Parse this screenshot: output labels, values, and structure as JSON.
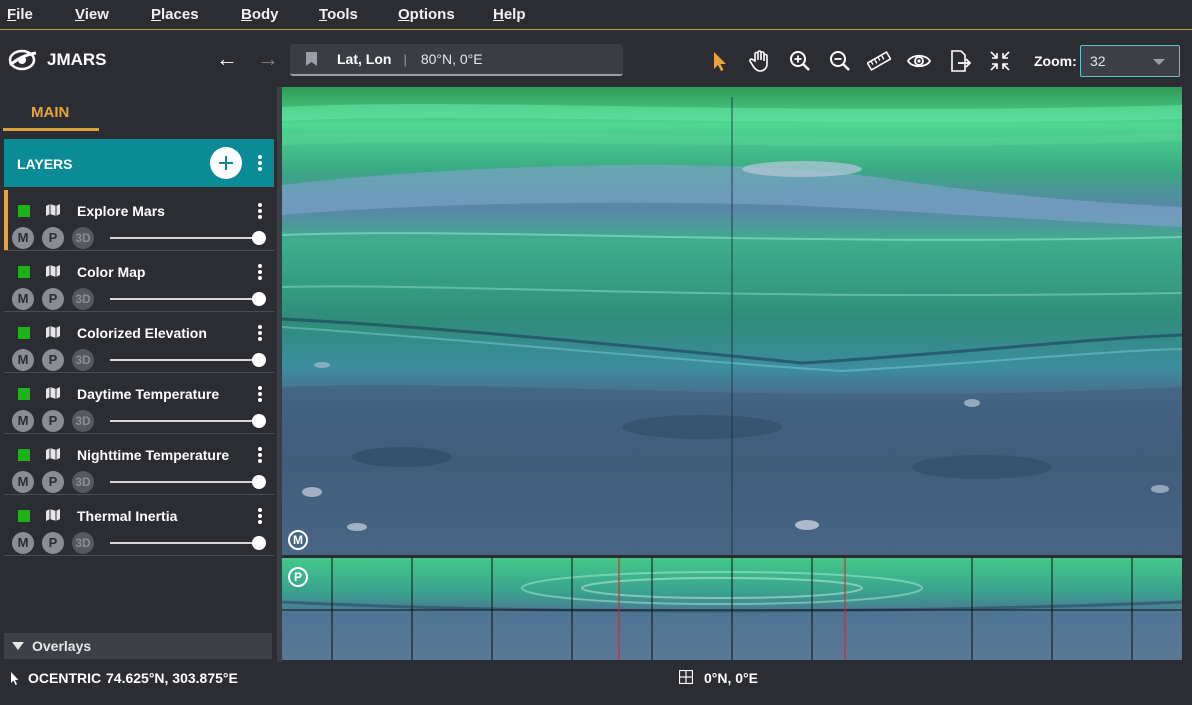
{
  "menu": [
    {
      "label": "File",
      "hotkey": "F",
      "rest": "ile"
    },
    {
      "label": "View",
      "hotkey": "V",
      "rest": "iew"
    },
    {
      "label": "Places",
      "hotkey": "P",
      "rest": "laces"
    },
    {
      "label": "Body",
      "hotkey": "B",
      "rest": "ody"
    },
    {
      "label": "Tools",
      "hotkey": "T",
      "rest": "ools"
    },
    {
      "label": "Options",
      "hotkey": "O",
      "rest": "ptions"
    },
    {
      "label": "Help",
      "hotkey": "H",
      "rest": "elp"
    }
  ],
  "toolbar": {
    "app_title": "JMARS",
    "coord_mode": "Lat, Lon",
    "coord_separator": "|",
    "coord_value": "80°N, 0°E",
    "tools": [
      "pointer-icon",
      "pan-hand-icon",
      "zoom-in-icon",
      "zoom-out-icon",
      "ruler-icon",
      "eye-icon",
      "export-icon",
      "shrink-icon"
    ],
    "zoom_label": "Zoom:",
    "zoom_value": "32",
    "accent_color": "#e8a33c"
  },
  "sidebar": {
    "tab_label": "MAIN",
    "layers_title": "LAYERS",
    "pill_labels": {
      "m": "M",
      "p": "P",
      "three_d": "3D"
    },
    "layers": [
      {
        "name": "Explore Mars",
        "visible": true,
        "opacity": 1.0,
        "selected": true
      },
      {
        "name": "Color Map",
        "visible": true,
        "opacity": 1.0,
        "selected": false
      },
      {
        "name": "Colorized Elevation",
        "visible": true,
        "opacity": 1.0,
        "selected": false
      },
      {
        "name": "Daytime Temperature",
        "visible": true,
        "opacity": 1.0,
        "selected": false
      },
      {
        "name": "Nighttime Temperature",
        "visible": true,
        "opacity": 1.0,
        "selected": false
      },
      {
        "name": "Thermal Inertia",
        "visible": true,
        "opacity": 1.0,
        "selected": false
      }
    ],
    "overlays_label": "Overlays",
    "layer_color": "#1db219",
    "header_color": "#0a8b96"
  },
  "map": {
    "main_badge": "M",
    "panner_badge": "P"
  },
  "status": {
    "projection": "OCENTRIC",
    "cursor_coord": "74.625°N, 303.875°E",
    "center_coord": "0°N, 0°E"
  }
}
